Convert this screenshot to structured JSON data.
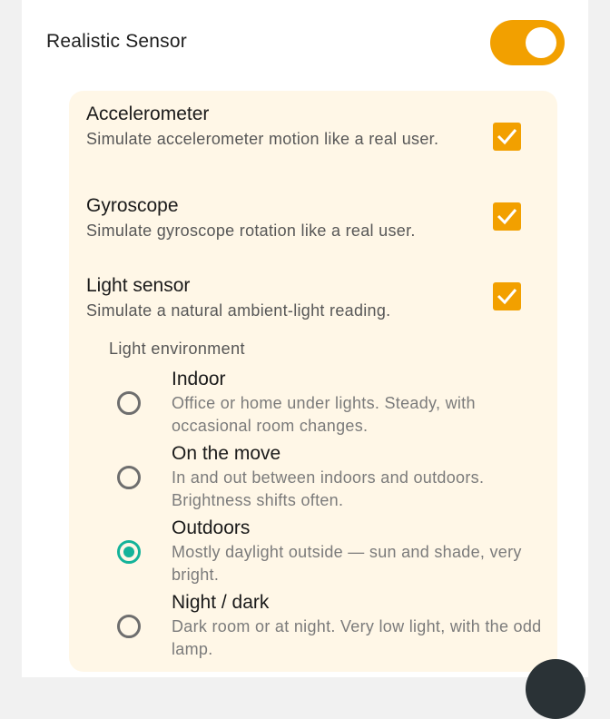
{
  "header": {
    "title": "Realistic Sensor",
    "toggle_on": true
  },
  "sensors": [
    {
      "title": "Accelerometer",
      "description": "Simulate accelerometer motion like a real user.",
      "checked": true
    },
    {
      "title": "Gyroscope",
      "description": "Simulate gyroscope rotation like a real user.",
      "checked": true
    },
    {
      "title": "Light sensor",
      "description": "Simulate a natural ambient-light reading.",
      "checked": true
    }
  ],
  "light_environment": {
    "label": "Light environment",
    "options": [
      {
        "title": "Indoor",
        "description": "Office or home under lights. Steady, with occasional room changes.",
        "selected": false
      },
      {
        "title": "On the move",
        "description": "In and out between indoors and outdoors. Brightness shifts often.",
        "selected": false
      },
      {
        "title": "Outdoors",
        "description": "Mostly daylight outside — sun and shade, very bright.",
        "selected": true
      },
      {
        "title": "Night / dark",
        "description": "Dark room or at night. Very low light, with the odd lamp.",
        "selected": false
      }
    ]
  },
  "colors": {
    "accent": "#f2a000",
    "radio_selected": "#14b39a",
    "panel_background": "#fff7e7"
  }
}
